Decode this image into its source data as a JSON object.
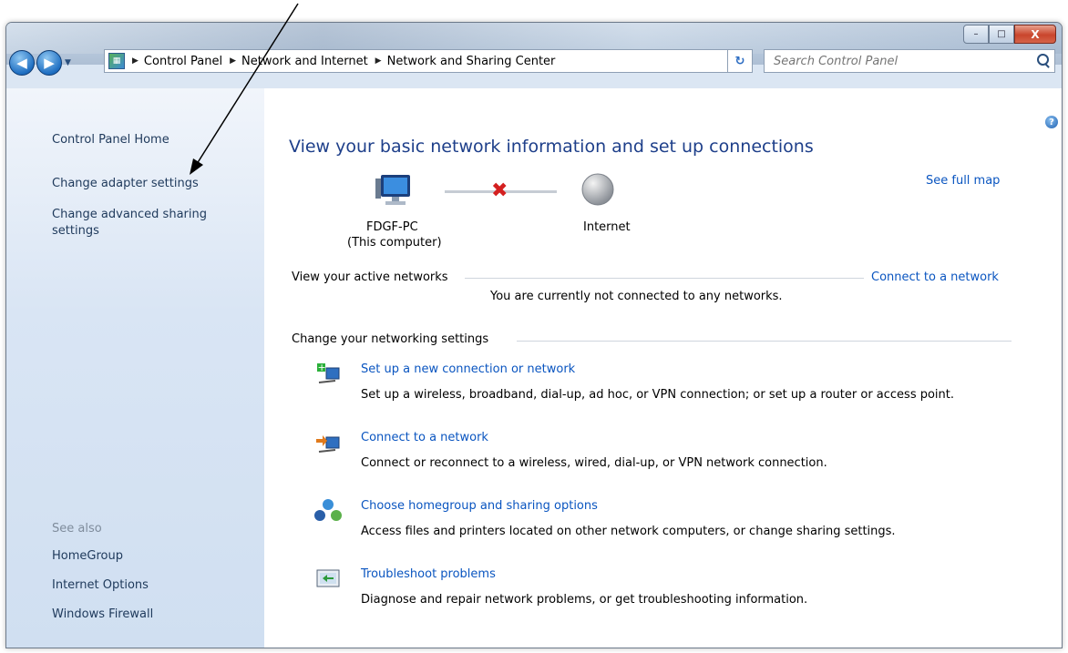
{
  "breadcrumb": [
    "Control Panel",
    "Network and Internet",
    "Network and Sharing Center"
  ],
  "search": {
    "placeholder": "Search Control Panel"
  },
  "window_controls": {
    "minimize": "–",
    "maximize": "□",
    "close": "X"
  },
  "sidebar": {
    "home": "Control Panel Home",
    "tasks": [
      "Change adapter settings",
      "Change advanced sharing settings"
    ],
    "see_also_label": "See also",
    "see_also": [
      "HomeGroup",
      "Internet Options",
      "Windows Firewall"
    ]
  },
  "main": {
    "title": "View your basic network information and set up connections",
    "see_full_map": "See full map",
    "map": {
      "computer_name": "FDGF-PC",
      "computer_sub": "(This computer)",
      "internet_label": "Internet",
      "connection_status": "disconnected"
    },
    "active_networks": {
      "label": "View your active networks",
      "action": "Connect to a network",
      "status": "You are currently not connected to any networks."
    },
    "networking_settings": {
      "label": "Change your networking settings",
      "items": [
        {
          "title": "Set up a new connection or network",
          "desc": "Set up a wireless, broadband, dial-up, ad hoc, or VPN connection; or set up a router or access point.",
          "icon": "new-connection-icon"
        },
        {
          "title": "Connect to a network",
          "desc": "Connect or reconnect to a wireless, wired, dial-up, or VPN network connection.",
          "icon": "connect-network-icon"
        },
        {
          "title": "Choose homegroup and sharing options",
          "desc": "Access files and printers located on other network computers, or change sharing settings.",
          "icon": "homegroup-icon"
        },
        {
          "title": "Troubleshoot problems",
          "desc": "Diagnose and repair network problems, or get troubleshooting information.",
          "icon": "troubleshoot-icon"
        }
      ]
    }
  },
  "colors": {
    "link": "#0a55c0",
    "title": "#1e3f8a",
    "error": "#d42020"
  }
}
